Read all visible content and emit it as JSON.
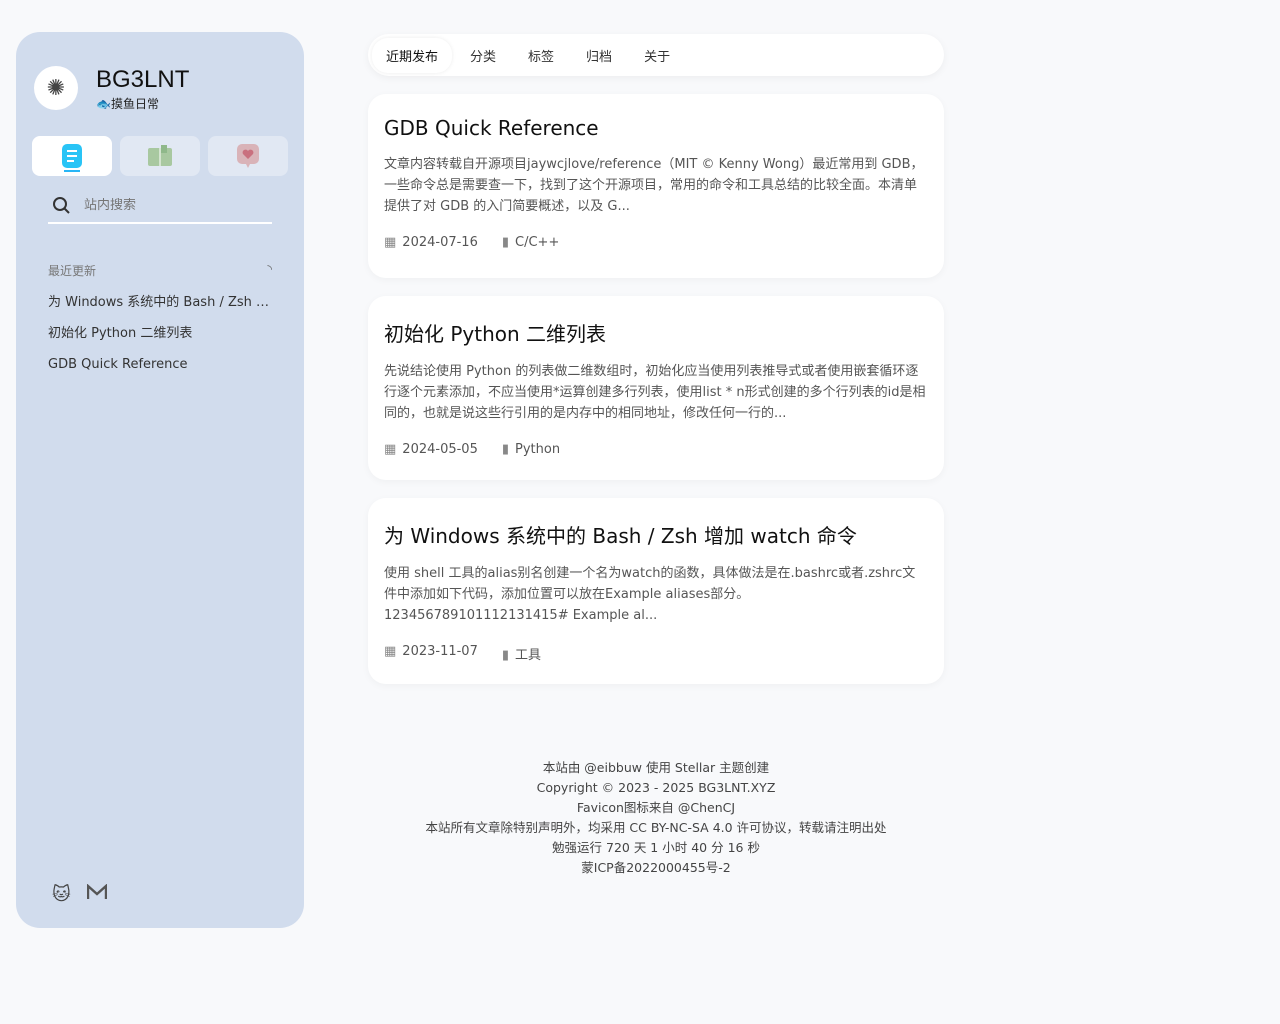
{
  "site": {
    "title": "BG3LNT",
    "subtitle_icon": "🐟",
    "subtitle": "摸鱼日常"
  },
  "sidebar": {
    "tabs": [
      {
        "icon": "document-icon"
      },
      {
        "icon": "book-icon"
      },
      {
        "icon": "heart-icon"
      }
    ],
    "search_placeholder": "站内搜索",
    "recent_title": "最近更新",
    "recent": [
      "为 Windows 系统中的 Bash / Zsh 增加 watch 命令",
      "初始化 Python 二维列表",
      "GDB Quick Reference"
    ]
  },
  "nav": [
    "近期发布",
    "分类",
    "标签",
    "归档",
    "关于"
  ],
  "posts": [
    {
      "title": "GDB Quick Reference",
      "excerpt": "文章内容转载自开源项目jaywcjlove/reference（MIT © Kenny Wong）最近常用到 GDB，一些命令总是需要查一下，找到了这个开源项目，常用的命令和工具总结的比较全面。本清单提供了对 GDB 的入门简要概述，以及 G...",
      "date": "2024-07-16",
      "category": "C/C++"
    },
    {
      "title": "初始化 Python 二维列表",
      "excerpt": "先说结论使用 Python 的列表做二维数组时，初始化应当使用列表推导式或者使用嵌套循环逐行逐个元素添加，不应当使用*运算创建多行列表，使用list * n形式创建的多个行列表的id是相同的，也就是说这些行引用的是内存中的相同地址，修改任何一行的...",
      "date": "2024-05-05",
      "category": "Python"
    },
    {
      "title": "为 Windows 系统中的 Bash / Zsh 增加 watch 命令",
      "excerpt": "使用 shell 工具的alias别名创建一个名为watch的函数，具体做法是在.bashrc或者.zshrc文件中添加如下代码，添加位置可以放在Example aliases部分。123456789101112131415# Example al...",
      "date": "2023-11-07",
      "category": "工具"
    }
  ],
  "footer": [
    "本站由 @eibbuw 使用 Stellar 主题创建",
    "Copyright © 2023 - 2025 BG3LNT.XYZ",
    "Favicon图标来自 @ChenCJ",
    "本站所有文章除特别声明外，均采用 CC BY-NC-SA 4.0 许可协议，转载请注明出处",
    "勉强运行 720 天 1 小时 40 分 16 秒",
    "蒙ICP备2022000455号-2"
  ]
}
